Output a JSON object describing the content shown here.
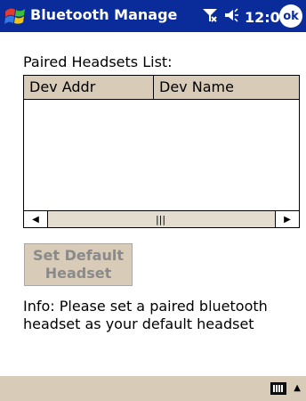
{
  "app": {
    "title": "Bluetooth Manage"
  },
  "status": {
    "signal_icon": "signal-icon",
    "volume_icon": "volume-icon",
    "time": "12:04",
    "ok_label": "ok"
  },
  "main": {
    "list_label": "Paired Headsets List:",
    "columns": [
      "Dev Addr",
      "Dev Name"
    ],
    "rows": [],
    "scrollbar": {
      "left": "◀",
      "thumb": "|||",
      "right": "▶"
    },
    "set_default_button": "Set Default Headset",
    "info_text": "Info: Please set a paired bluetooth headset as your default headset"
  },
  "bottom": {
    "keyboard_icon": "keyboard-icon",
    "up_arrow": "▲"
  },
  "colors": {
    "titlebar": "#0a2b9a",
    "panel": "#d8cbb8",
    "disabled_text": "#8a8a8a"
  }
}
